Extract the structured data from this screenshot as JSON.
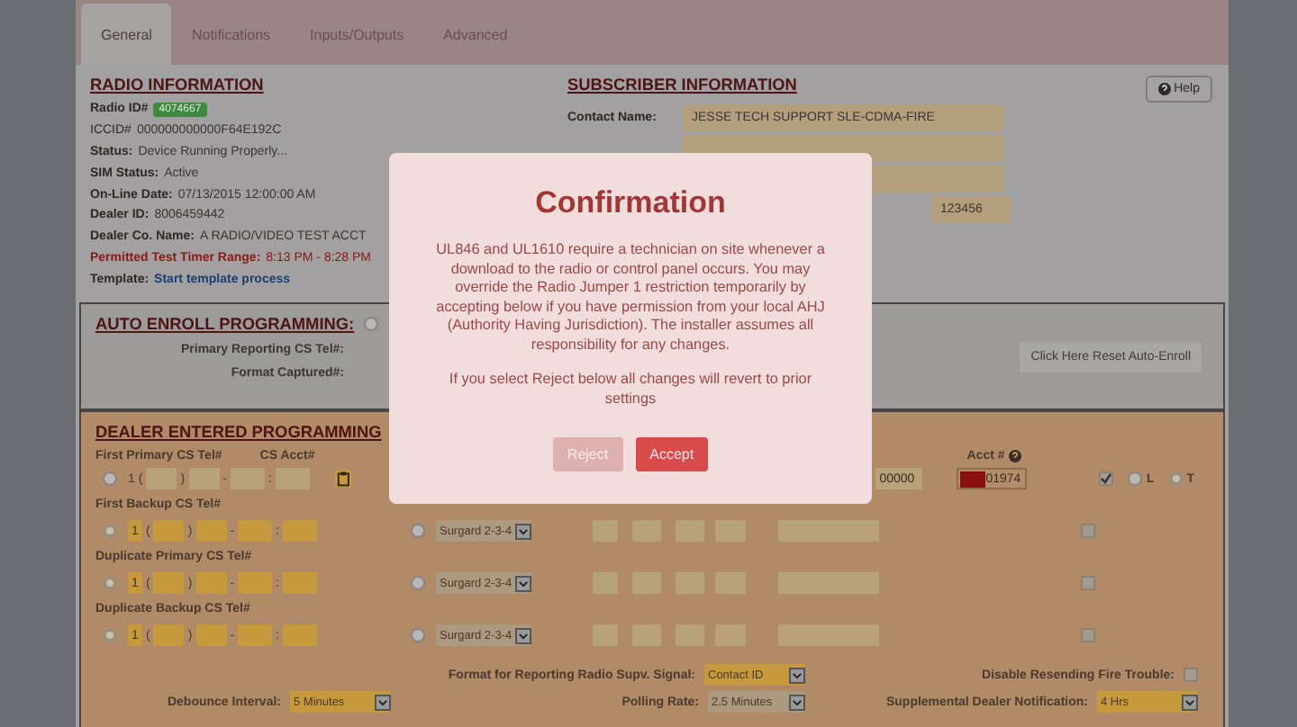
{
  "tabs": [
    {
      "label": "General",
      "selected": true
    },
    {
      "label": "Notifications",
      "selected": false
    },
    {
      "label": "Inputs/Outputs",
      "selected": false
    },
    {
      "label": "Advanced",
      "selected": false
    }
  ],
  "radio_info": {
    "title": "RADIO INFORMATION",
    "lines": [
      {
        "kind": "badge",
        "label": "Radio ID#",
        "value": "4074667"
      },
      {
        "kind": "plain",
        "label": "ICCID#",
        "value": "000000000000F64E192C"
      },
      {
        "kind": "text",
        "label": "Status:",
        "value": "Device Running Properly..."
      },
      {
        "kind": "text",
        "label": "SIM Status:",
        "value": "Active"
      },
      {
        "kind": "text",
        "label": "On-Line Date:",
        "value": "07/13/2015 12:00:00 AM"
      },
      {
        "kind": "text",
        "label": "Dealer ID:",
        "value": "8006459442"
      },
      {
        "kind": "text",
        "label": "Dealer Co. Name:",
        "value": "A RADIO/VIDEO TEST ACCT"
      },
      {
        "kind": "alert",
        "label": "Permitted Test Timer Range:",
        "value": "8:13 PM - 8:28 PM"
      },
      {
        "kind": "link",
        "label": "Template:",
        "value": "Start template process"
      }
    ]
  },
  "subscriber": {
    "title": "SUBSCRIBER INFORMATION",
    "help_button": "Help",
    "fields": [
      {
        "label": "Contact Name:",
        "value": "JESSE TECH SUPPORT SLE-CDMA-FIRE",
        "kind": "wide"
      },
      {
        "kind": "wide"
      },
      {
        "kind": "wide"
      },
      {
        "value": "123456",
        "kind": "short"
      }
    ]
  },
  "auto_enroll": {
    "title": "AUTO ENROLL PROGRAMMING:",
    "selected": false,
    "labels": [
      "Primary Reporting CS Tel#:",
      "Format Captured#:"
    ],
    "reset_button": "Click Here Reset Auto-Enroll"
  },
  "dealer": {
    "title": "DEALER ENTERED PROGRAMMING",
    "primary": {
      "label": "First Primary CS Tel#",
      "acct_label": "CS Acct#",
      "selected": false,
      "country": "1",
      "separators": [
        "(",
        ")",
        "-",
        ":"
      ],
      "right_value": "00000",
      "acct_header": "Acct #",
      "acct_value": "01974",
      "checked": true,
      "line_options": [
        {
          "label": "L",
          "selected": false
        },
        {
          "label": "T",
          "selected": true
        }
      ]
    },
    "rows": [
      {
        "label": "First Backup CS Tel#",
        "selected": true,
        "country": "1",
        "separators": [
          "(",
          ")",
          "-",
          ":"
        ],
        "format_selected": false,
        "format": "Surgard 2-3-4",
        "checked": false
      },
      {
        "label": "Duplicate Primary CS Tel#",
        "selected": true,
        "country": "1",
        "separators": [
          "(",
          ")",
          "-",
          ":"
        ],
        "format_selected": false,
        "format": "Surgard 2-3-4",
        "checked": false
      },
      {
        "label": "Duplicate Backup CS Tel#",
        "selected": true,
        "country": "1",
        "separators": [
          "(",
          ")",
          "-",
          ":"
        ],
        "format_selected": false,
        "format": "Surgard 2-3-4",
        "checked": false
      }
    ],
    "settings": [
      [
        {
          "kind": "select",
          "label": "Format for Reporting Radio Supv. Signal:",
          "value": "Contact ID",
          "disabled": false
        },
        {
          "kind": "checkbox",
          "label": "Disable Resending Fire Trouble:",
          "checked": false
        }
      ],
      [
        {
          "kind": "select",
          "label": "Debounce Interval:",
          "value": "5 Minutes",
          "disabled": false
        },
        {
          "kind": "select",
          "label": "Polling Rate:",
          "value": "2.5 Minutes",
          "disabled": true
        },
        {
          "kind": "select",
          "label": "Supplemental Dealer Notification:",
          "value": "4 Hrs",
          "disabled": false
        }
      ]
    ]
  },
  "modal": {
    "title": "Confirmation",
    "paragraphs": [
      "UL846 and UL1610 require a technician on site whenever a download to the radio or control panel occurs. You may override the Radio Jumper 1 restriction temporarily by accepting below if you have permission from your local AHJ (Authority Having Jurisdiction). The installer assumes all responsibility for any changes.",
      "If you select Reject below all changes will revert to prior settings"
    ],
    "buttons": [
      {
        "label": "Reject",
        "kind": "secondary"
      },
      {
        "label": "Accept",
        "kind": "primary"
      }
    ]
  }
}
